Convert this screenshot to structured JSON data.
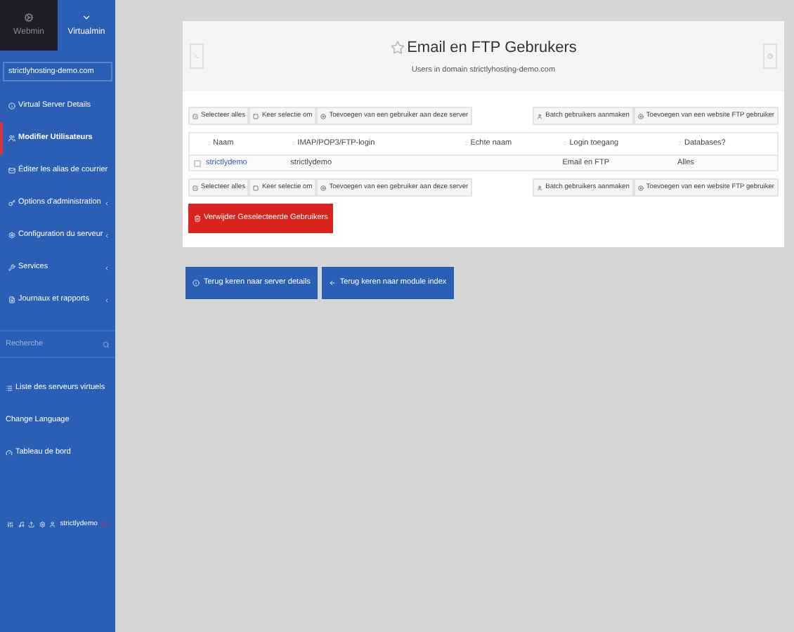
{
  "sidebar": {
    "tabs": [
      {
        "label": "Webmin",
        "selected": false
      },
      {
        "label": "Virtualmin",
        "selected": true
      }
    ],
    "domain": "strictlyhosting-demo.com",
    "menu": [
      {
        "label": "Virtual Server Details",
        "selected": false,
        "submenu": false
      },
      {
        "label": "Modifier Utilisateurs",
        "selected": true,
        "submenu": false
      },
      {
        "label": "Éditer les alias de courrier",
        "selected": false,
        "submenu": false
      },
      {
        "label": "Options d'administration",
        "selected": false,
        "submenu": true
      },
      {
        "label": "Configuration du serveur",
        "selected": false,
        "submenu": true
      },
      {
        "label": "Services",
        "selected": false,
        "submenu": true
      },
      {
        "label": "Journaux et rapports",
        "selected": false,
        "submenu": true
      }
    ],
    "search": {
      "placeholder": "Recherche"
    },
    "links": [
      "Liste des serveurs virtuels",
      "Change Language",
      "Tableau de bord"
    ],
    "user": "strictlydemo"
  },
  "panel": {
    "title": "Email en FTP Gebrukers",
    "subtitle": "Users in domain strictlyhosting-demo.com",
    "toolbar_top": {
      "left": [
        "Selecteer alles",
        "Keer selectie om",
        "Toevoegen van een gebruiker aan deze server"
      ],
      "right": [
        "Batch gebruikers aanmaken",
        "Toevoegen van een website FTP gebruiker"
      ]
    },
    "table": {
      "columns": [
        "Naam",
        "IMAP/POP3/FTP-login",
        "Echte naam",
        "Login toegang",
        "Databases?"
      ],
      "rows": [
        {
          "checked": false,
          "cells": [
            "strictlydemo",
            "strictlydemo",
            "",
            "Email en FTP",
            "Alles"
          ]
        }
      ]
    },
    "toolbar_bottom": {
      "left": [
        "Selecteer alles",
        "Keer selectie om",
        "Toevoegen van een gebruiker aan deze server"
      ],
      "right": [
        "Batch gebruikers aanmaken",
        "Toevoegen van een website FTP gebruiker"
      ]
    },
    "delete_button": "Verwijder Geselecteerde Gebruikers"
  },
  "footer_buttons": [
    "Terug keren naar server details",
    "Terug keren naar module index"
  ]
}
